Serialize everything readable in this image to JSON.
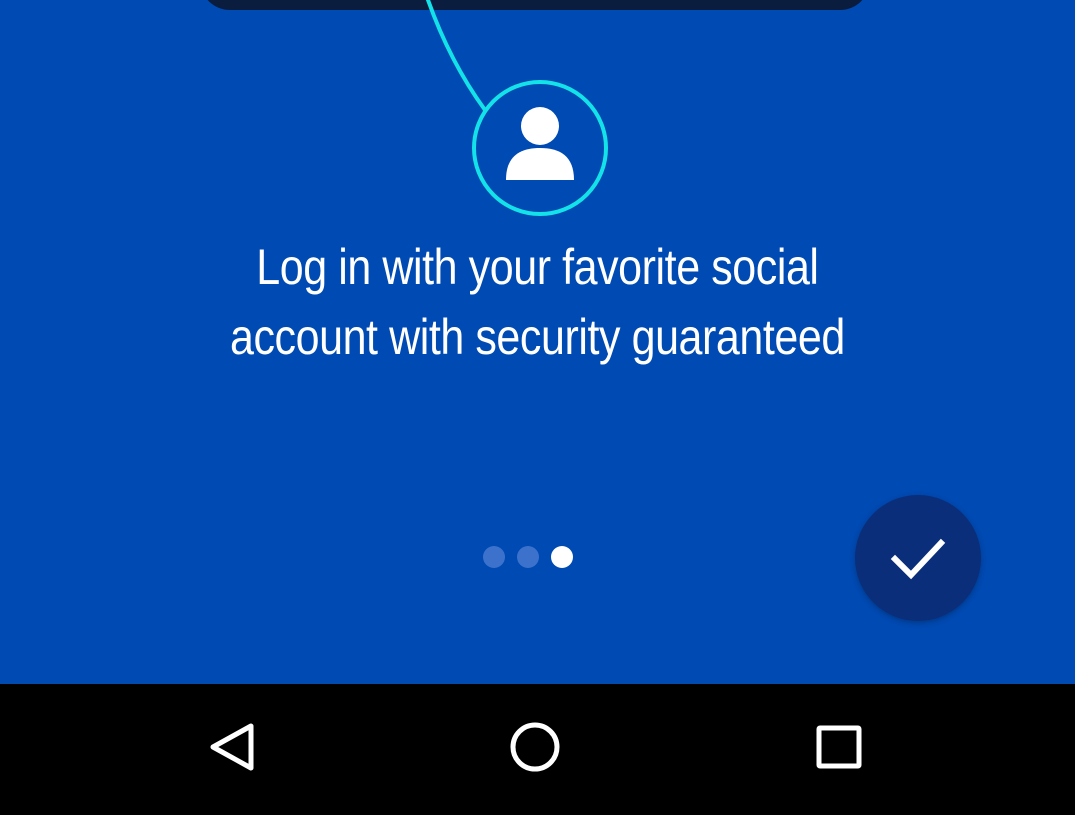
{
  "colors": {
    "background": "#004AB3",
    "accent_cyan": "#13E2E8",
    "phone_frame": "#0B1D3F",
    "fab": "#0A2E7A",
    "dot_inactive": "#3C72CC",
    "dot_active": "#FFFFFF",
    "nav_bar": "#000000",
    "nav_icon": "#FFFFFF"
  },
  "onboarding": {
    "headline_line1": "Log in with your favorite social",
    "headline_line2": "account with security guaranteed",
    "avatar_icon": "user-icon",
    "pager": {
      "total": 3,
      "active_index": 2
    },
    "done_button_icon": "checkmark-icon"
  },
  "navigation_bar": {
    "back_icon": "back-triangle-icon",
    "home_icon": "home-circle-icon",
    "recents_icon": "recents-square-icon"
  }
}
